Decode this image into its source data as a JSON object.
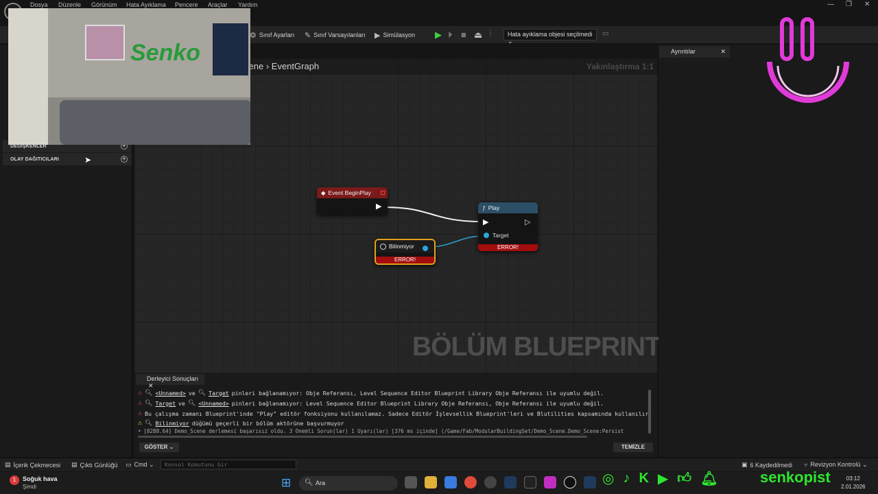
{
  "menu": [
    "Dosya",
    "Düzenle",
    "Görünüm",
    "Hata Ayıklama",
    "Pencere",
    "Araçlar",
    "Yardım"
  ],
  "window_controls": [
    "—",
    "❐",
    "✕"
  ],
  "toolbar": {
    "class_settings": "Sınıf Ayarları",
    "class_defaults": "Sınıf Varsayılanları",
    "simulation": "Simülasyon",
    "debug_object": "Hata ayıklama objesi seçilmedi ⌄"
  },
  "left_panel": {
    "variables": "DEĞİŞKENLER",
    "event_dispatchers": "OLAY DAĞITICILARI"
  },
  "graph": {
    "breadcrumb_parent": "cene",
    "breadcrumb_current": "EventGraph",
    "zoom": "Yakınlaştırma 1:1",
    "watermark": "BÖLÜM BLUEPRINT'İ"
  },
  "nodes": {
    "begin_play": {
      "title": "Event BeginPlay"
    },
    "play": {
      "title": "Play",
      "pin_target": "Target",
      "error": "ERROR!"
    },
    "unknown": {
      "title": "Bilinmiyor",
      "error": "ERROR!"
    }
  },
  "details": {
    "tab": "Ayrıntılar"
  },
  "compiler": {
    "tab": "Derleyici Sonuçları",
    "messages": [
      {
        "type": "error",
        "a": "<Unnamed>",
        "mid": " ve ",
        "b": "Target",
        "text": " pinleri bağlanamıyor: Obje Referansı, Level Sequence Editor Blueprint Library Obje Referansı ile uyumlu değil."
      },
      {
        "type": "error",
        "a": "Target",
        "mid": " ve ",
        "b": "<Unnamed>",
        "text": " pinleri bağlanamıyor: Level Sequence Editor Blueprint Library Obje Referansı, Obje Referansı ile uyumlu değil."
      },
      {
        "type": "error",
        "text": "Bu çalışma zamanı Blueprint'inde \"Play\" editör fonksiyonu kullanılamaz. Sadece Editör İşlevsellik Blueprint'leri ve Blutilities kapsamında kullanılır."
      },
      {
        "type": "warning",
        "a": "Bilinmiyor",
        "text": " düğümü geçerli bir bölüm aktörüne başvurmuyor"
      },
      {
        "type": "info",
        "text": "[8288.64] Demo_Scene derlemesi başarısız oldu. 3 Önemli Sorun(lar) 1 Uyarı(lar) [376 ms içinde] (/Game/Fab/ModularBuildingSet/Demo_Scene.Demo_Scene:Persist"
      }
    ],
    "show_button": "GÖSTER ⌄",
    "clear_button": "TEMİZLE"
  },
  "status_bar": {
    "content_drawer": "İçerik Çekmecesi",
    "output_log": "Çıktı Günlüğü",
    "cmd": "Cmd ⌄",
    "console_placeholder": "Konsol Komutunu Gir",
    "saved": "6 Kaydedilmedi",
    "revision": "Revizyon Kontrolü ⌄"
  },
  "taskbar": {
    "weather_title": "Soğuk hava",
    "weather_sub": "Şimdi",
    "weather_badge": "1",
    "search": "Ara",
    "social_name": "senkopist",
    "time": "03:12",
    "date": "2.01.2026"
  },
  "webcam": {
    "wall_text": "Senko"
  },
  "colors": {
    "error_red": "#a30d0d",
    "social_green": "#2ee62e",
    "smiley_pink": "#e03ad8",
    "play_green": "#3fd13f"
  }
}
